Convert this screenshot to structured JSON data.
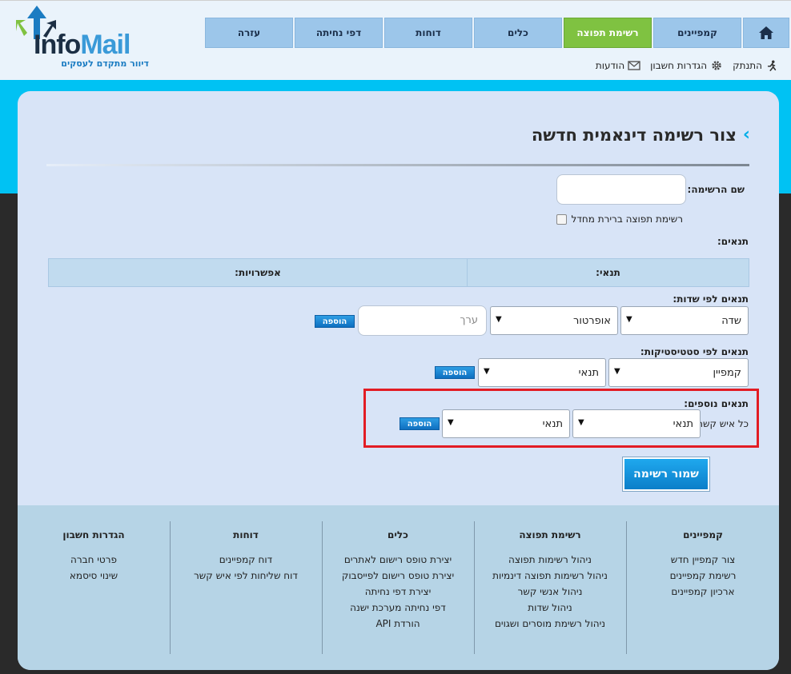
{
  "logo": {
    "info": "Info",
    "mail": "Mail",
    "tagline": "דיוור מתקדם לעסקים"
  },
  "nav": {
    "home": "home-icon",
    "items": [
      {
        "label": "קמפיינים",
        "active": false
      },
      {
        "label": "רשימת תפוצה",
        "active": true
      },
      {
        "label": "כלים",
        "active": false
      },
      {
        "label": "דוחות",
        "active": false
      },
      {
        "label": "דפי נחיתה",
        "active": false
      },
      {
        "label": "עזרה",
        "active": false
      }
    ]
  },
  "utility": {
    "messages": "הודעות",
    "settings": "הגדרות חשבון",
    "logout": "התנתק"
  },
  "page": {
    "title": "צור רשימה דינאמית חדשה"
  },
  "form": {
    "list_name_label": "שם הרשימה:",
    "list_name_value": "",
    "checkbox_label": "רשימת תפוצה ברירת מחדל",
    "conditions_label": "תנאים:",
    "table_headers": {
      "condition": "תנאי:",
      "options": "אפשרויות:"
    },
    "by_fields": {
      "label": "תנאים לפי שדות:",
      "field": "שדה",
      "operator": "אופרטור",
      "value_placeholder": "ערך",
      "add": "הוספה"
    },
    "by_stats": {
      "label": "תנאים לפי סטטיסטיקות:",
      "campaign": "קמפיין",
      "condition": "תנאי",
      "add": "הוספה"
    },
    "additional": {
      "label": "תנאים נוספים:",
      "prefix": "כל איש קשר",
      "condition1": "תנאי",
      "condition2": "תנאי",
      "add": "הוספה"
    },
    "save": "שמור רשימה"
  },
  "footer": {
    "columns": [
      {
        "heading": "קמפיינים",
        "links": [
          "צור קמפיין חדש",
          "רשימת קמפיינים",
          "ארכיון קמפיינים"
        ]
      },
      {
        "heading": "רשימת תפוצה",
        "links": [
          "ניהול רשימות תפוצה",
          "ניהול רשימות תפוצה דינמיות",
          "ניהול אנשי קשר",
          "ניהול שדות",
          "ניהול רשימת מוסרים ושגוים"
        ]
      },
      {
        "heading": "כלים",
        "links": [
          "יצירת טופס רישום לאתרים",
          "יצירת טופס רישום לפייסבוק",
          "יצירת דפי נחיתה",
          "דפי נחיתה מערכת ישנה",
          "הורדת API"
        ]
      },
      {
        "heading": "דוחות",
        "links": [
          "דוח קמפיינים",
          "דוח שליחות לפי איש קשר"
        ]
      },
      {
        "heading": "הגדרות חשבון",
        "links": [
          "פרטי חברה",
          "שינוי סיסמא"
        ]
      }
    ]
  },
  "colors": {
    "accent": "#00c2f3",
    "nav_active": "#7fc241",
    "highlight": "#e21c24",
    "button": "#0e7fcb"
  }
}
